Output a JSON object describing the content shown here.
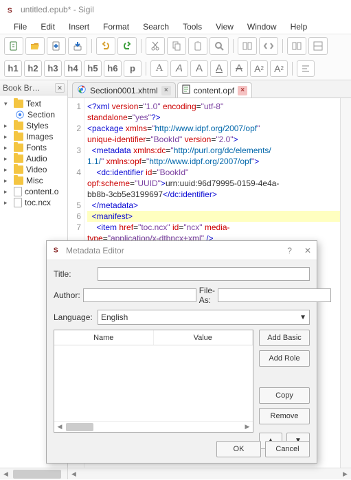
{
  "window": {
    "title": "untitled.epub* - Sigil"
  },
  "menu": [
    "File",
    "Edit",
    "Insert",
    "Format",
    "Search",
    "Tools",
    "View",
    "Window",
    "Help"
  ],
  "heading_buttons": [
    "h1",
    "h2",
    "h3",
    "h4",
    "h5",
    "h6",
    "p"
  ],
  "sidebar": {
    "title": "Book Br…",
    "items": [
      {
        "label": "Text",
        "type": "folder",
        "lvl": 1,
        "exp": true
      },
      {
        "label": "Section",
        "type": "chrome",
        "lvl": 2
      },
      {
        "label": "Styles",
        "type": "folder",
        "lvl": 1
      },
      {
        "label": "Images",
        "type": "folder",
        "lvl": 1
      },
      {
        "label": "Fonts",
        "type": "folder",
        "lvl": 1
      },
      {
        "label": "Audio",
        "type": "folder",
        "lvl": 1
      },
      {
        "label": "Video",
        "type": "folder",
        "lvl": 1
      },
      {
        "label": "Misc",
        "type": "folder",
        "lvl": 1
      },
      {
        "label": "content.o",
        "type": "file",
        "lvl": 1
      },
      {
        "label": "toc.ncx",
        "type": "file",
        "lvl": 1
      }
    ]
  },
  "tabs": [
    {
      "label": "Section0001.xhtml",
      "icon": "chrome",
      "active": false
    },
    {
      "label": "content.opf",
      "icon": "file",
      "active": true
    }
  ],
  "code": {
    "gutter": [
      "1",
      "2",
      "3",
      "4",
      "5",
      "6",
      "7"
    ],
    "lines": [
      [
        {
          "c": "t-kw",
          "t": "<?xml"
        },
        {
          "t": " "
        },
        {
          "c": "t-attr",
          "t": "version"
        },
        {
          "t": "="
        },
        {
          "c": "t-str",
          "t": "\"1.0\""
        },
        {
          "t": " "
        },
        {
          "c": "t-attr",
          "t": "encoding"
        },
        {
          "t": "="
        },
        {
          "c": "t-str",
          "t": "\"utf-8\""
        },
        {
          "t": " "
        }
      ],
      [
        {
          "c": "t-attr",
          "t": "standalone"
        },
        {
          "t": "="
        },
        {
          "c": "t-str",
          "t": "\"yes\""
        },
        {
          "c": "t-kw",
          "t": "?>"
        }
      ],
      [
        {
          "c": "t-kw",
          "t": "<package"
        },
        {
          "t": " "
        },
        {
          "c": "t-attr",
          "t": "xmlns"
        },
        {
          "t": "="
        },
        {
          "c": "t-str",
          "t": "\""
        },
        {
          "c": "t-url",
          "t": "http://www.idpf.org/2007/opf"
        },
        {
          "c": "t-str",
          "t": "\""
        },
        {
          "t": " "
        }
      ],
      [
        {
          "c": "t-attr",
          "t": "unique-identifier"
        },
        {
          "t": "="
        },
        {
          "c": "t-str",
          "t": "\"BookId\""
        },
        {
          "t": " "
        },
        {
          "c": "t-attr",
          "t": "version"
        },
        {
          "t": "="
        },
        {
          "c": "t-str",
          "t": "\"2.0\""
        },
        {
          "c": "t-kw",
          "t": ">"
        }
      ],
      [
        {
          "t": "  "
        },
        {
          "c": "t-kw",
          "t": "<metadata"
        },
        {
          "t": " "
        },
        {
          "c": "t-attr",
          "t": "xmlns:dc"
        },
        {
          "t": "="
        },
        {
          "c": "t-str",
          "t": "\""
        },
        {
          "c": "t-url",
          "t": "http://purl.org/dc/elements/"
        }
      ],
      [
        {
          "c": "t-url",
          "t": "1.1/"
        },
        {
          "c": "t-str",
          "t": "\""
        },
        {
          "t": " "
        },
        {
          "c": "t-attr",
          "t": "xmlns:opf"
        },
        {
          "t": "="
        },
        {
          "c": "t-str",
          "t": "\""
        },
        {
          "c": "t-url",
          "t": "http://www.idpf.org/2007/opf"
        },
        {
          "c": "t-str",
          "t": "\""
        },
        {
          "c": "t-kw",
          "t": ">"
        }
      ],
      [
        {
          "t": "    "
        },
        {
          "c": "t-kw",
          "t": "<dc:identifier"
        },
        {
          "t": " "
        },
        {
          "c": "t-attr",
          "t": "id"
        },
        {
          "t": "="
        },
        {
          "c": "t-str",
          "t": "\"BookId\""
        },
        {
          "t": " "
        }
      ],
      [
        {
          "c": "t-attr",
          "t": "opf:scheme"
        },
        {
          "t": "="
        },
        {
          "c": "t-str",
          "t": "\"UUID\""
        },
        {
          "c": "t-kw",
          "t": ">"
        },
        {
          "t": "urn:uuid:96d79995-0159-4e4a-"
        }
      ],
      [
        {
          "t": "bb8b-3cb5e3199697"
        },
        {
          "c": "t-kw",
          "t": "</dc:identifier>"
        }
      ],
      [
        {
          "t": "  "
        },
        {
          "c": "t-kw",
          "t": "</metadata>"
        }
      ],
      [
        {
          "t": "  "
        },
        {
          "c": "t-kw",
          "t": "<manifest>"
        }
      ],
      [
        {
          "t": "    "
        },
        {
          "c": "t-kw",
          "t": "<item"
        },
        {
          "t": " "
        },
        {
          "c": "t-attr",
          "t": "href"
        },
        {
          "t": "="
        },
        {
          "c": "t-str",
          "t": "\"toc.ncx\""
        },
        {
          "t": " "
        },
        {
          "c": "t-attr",
          "t": "id"
        },
        {
          "t": "="
        },
        {
          "c": "t-str",
          "t": "\"ncx\""
        },
        {
          "t": " "
        },
        {
          "c": "t-attr",
          "t": "media-"
        }
      ],
      [
        {
          "c": "t-attr",
          "t": "type"
        },
        {
          "t": "="
        },
        {
          "c": "t-str",
          "t": "\"application/x-dtbncx+xml\""
        },
        {
          "t": " "
        },
        {
          "c": "t-kw",
          "t": "/>"
        }
      ]
    ],
    "line_map": [
      0,
      0,
      1,
      1,
      2,
      2,
      3,
      3,
      3,
      4,
      5,
      6,
      6
    ],
    "hl_line": 5
  },
  "dialog": {
    "title": "Metadata Editor",
    "labels": {
      "title": "Title:",
      "author": "Author:",
      "fileas": "File-As:",
      "language": "Language:"
    },
    "language_value": "English",
    "columns": [
      "Name",
      "Value"
    ],
    "buttons": {
      "add_basic": "Add Basic",
      "add_role": "Add Role",
      "copy": "Copy",
      "remove": "Remove",
      "ok": "OK",
      "cancel": "Cancel"
    }
  }
}
